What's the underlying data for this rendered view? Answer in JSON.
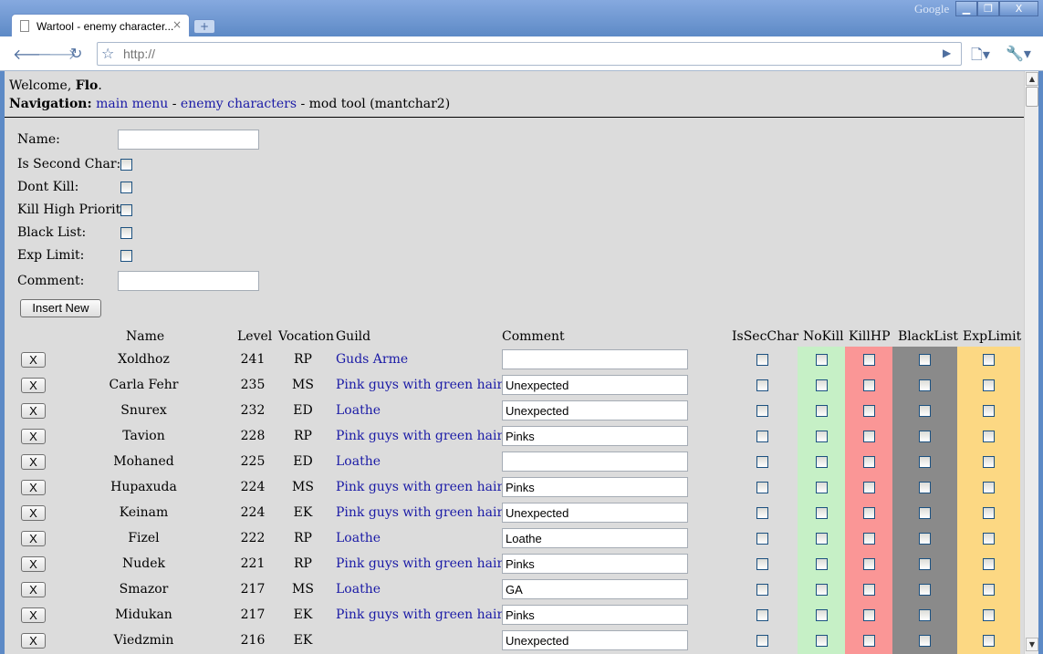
{
  "browser": {
    "tab_title": "Wartool - enemy character...",
    "tab_close": "×",
    "new_tab": "+",
    "brand": "Google",
    "window_buttons": {
      "minimize": "▁",
      "maximize": "❐",
      "close": "X"
    },
    "address_placeholder": "http://",
    "icons": {
      "back": "🡐",
      "forward": "🡒",
      "reload": "↻",
      "star": "☆",
      "go": "▶",
      "page_menu": "🗋▾",
      "tools_menu": "🔧▾"
    }
  },
  "header": {
    "welcome_prefix": "Welcome, ",
    "user": "Flo",
    "welcome_suffix": ".",
    "nav_label": "Navigation:",
    "nav_main_menu": "main menu",
    "nav_sep1": " - ",
    "nav_enemy_characters": "enemy characters",
    "nav_current": " - mod tool (mantchar2)"
  },
  "form": {
    "name_label": "Name:",
    "is_second_char_label": "Is Second Char:",
    "dont_kill_label": "Dont Kill:",
    "kill_high_priority_label": "Kill High Priority:",
    "black_list_label": "Black List:",
    "exp_limit_label": "Exp Limit:",
    "comment_label": "Comment:",
    "insert_button": "Insert New"
  },
  "table": {
    "headers": {
      "name": "Name",
      "level": "Level",
      "vocation": "Vocation",
      "guild": "Guild",
      "comment": "Comment",
      "is_sec_char": "IsSecChar",
      "no_kill": "NoKill",
      "kill_hp": "KillHP",
      "black_list": "BlackList",
      "exp_limit": "ExpLimit"
    },
    "delete_label": "X",
    "column_colors": {
      "no_kill": "#c6f0c6",
      "kill_hp": "#fa9696",
      "black_list": "#8a8a8a",
      "exp_limit": "#fcd883"
    },
    "rows": [
      {
        "name": "Xoldhoz",
        "level": "241",
        "vocation": "RP",
        "guild": "Guds Arme",
        "comment": ""
      },
      {
        "name": "Carla Fehr",
        "level": "235",
        "vocation": "MS",
        "guild": "Pink guys with green hair",
        "comment": "Unexpected"
      },
      {
        "name": "Snurex",
        "level": "232",
        "vocation": "ED",
        "guild": "Loathe",
        "comment": "Unexpected"
      },
      {
        "name": "Tavion",
        "level": "228",
        "vocation": "RP",
        "guild": "Pink guys with green hair",
        "comment": "Pinks"
      },
      {
        "name": "Mohaned",
        "level": "225",
        "vocation": "ED",
        "guild": "Loathe",
        "comment": ""
      },
      {
        "name": "Hupaxuda",
        "level": "224",
        "vocation": "MS",
        "guild": "Pink guys with green hair",
        "comment": "Pinks"
      },
      {
        "name": "Keinam",
        "level": "224",
        "vocation": "EK",
        "guild": "Pink guys with green hair",
        "comment": "Unexpected"
      },
      {
        "name": "Fizel",
        "level": "222",
        "vocation": "RP",
        "guild": "Loathe",
        "comment": "Loathe"
      },
      {
        "name": "Nudek",
        "level": "221",
        "vocation": "RP",
        "guild": "Pink guys with green hair",
        "comment": "Pinks"
      },
      {
        "name": "Smazor",
        "level": "217",
        "vocation": "MS",
        "guild": "Loathe",
        "comment": "GA"
      },
      {
        "name": "Midukan",
        "level": "217",
        "vocation": "EK",
        "guild": "Pink guys with green hair",
        "comment": "Pinks"
      },
      {
        "name": "Viedzmin",
        "level": "216",
        "vocation": "EK",
        "guild": "",
        "comment": "Unexpected"
      }
    ]
  }
}
